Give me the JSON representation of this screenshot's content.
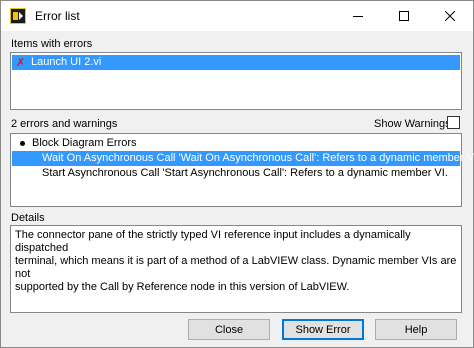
{
  "window": {
    "title": "Error list",
    "icon": "labview-app-icon",
    "controls": [
      "minimize-icon",
      "maximize-icon",
      "close-icon"
    ]
  },
  "items_section": {
    "label": "Items with errors",
    "items": [
      {
        "icon": "error-x-icon",
        "label": "Launch UI 2.vi",
        "selected": true
      }
    ]
  },
  "errors_section": {
    "count_label": "2 errors and warnings",
    "show_warnings_label": "Show Warnings",
    "show_warnings_checked": false,
    "group_label": "Block Diagram Errors",
    "errors": [
      {
        "label": "Wait On Asynchronous Call 'Wait On Asynchronous Call': Refers to a dynamic member VI.",
        "selected": true
      },
      {
        "label": "Start Asynchronous Call 'Start Asynchronous Call': Refers to a dynamic member VI.",
        "selected": false
      }
    ]
  },
  "details_section": {
    "label": "Details",
    "text": "The connector pane of the strictly typed VI reference input includes a dynamically dispatched\nterminal, which means it is part of a method of a LabVIEW class. Dynamic member VIs are not\nsupported by the Call by Reference node in this version of LabVIEW."
  },
  "buttons": {
    "close": "Close",
    "show_error": "Show Error",
    "help": "Help"
  },
  "colors": {
    "selection": "#3399ff",
    "error_icon": "#e01010",
    "default_button_border": "#0078d7"
  }
}
